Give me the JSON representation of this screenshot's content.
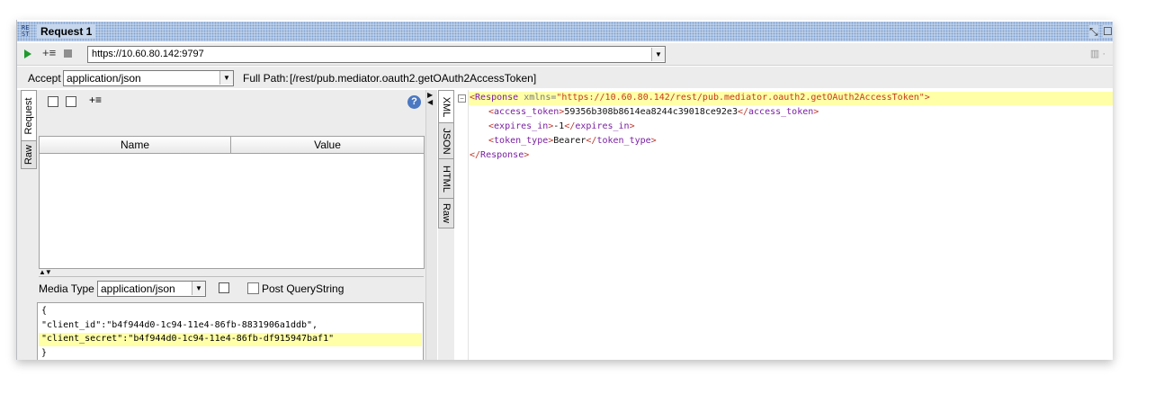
{
  "window": {
    "title": "Request 1",
    "badge_top": "RE",
    "badge_bottom": "ST",
    "controls": [
      "⤡",
      "☐"
    ]
  },
  "toolbar": {
    "url": "https://10.60.80.142:9797",
    "add_glyph": "+≡"
  },
  "accept": {
    "label": "Accept",
    "value": "application/json",
    "full_path_label": "Full Path:",
    "full_path": "[/rest/pub.mediator.oauth2.getOAuth2AccessToken]"
  },
  "left_tabs": [
    "Request",
    "Raw"
  ],
  "params": {
    "columns": [
      "Name",
      "Value"
    ],
    "rows": [],
    "help_glyph": "?"
  },
  "media": {
    "label": "Media Type",
    "value": "application/json",
    "post_qs_label": "Post QueryString"
  },
  "body_lines": [
    "{",
    "\"client_id\":\"b4f944d0-1c94-11e4-86fb-8831906a1ddb\",",
    "\"client_secret\":\"b4f944d0-1c94-11e4-86fb-df915947baf1\"",
    "}"
  ],
  "right_tabs": [
    "XML",
    "JSON",
    "HTML",
    "Raw"
  ],
  "response": {
    "root_tag": "Response",
    "xmlns_attr": "xmlns",
    "xmlns_value": "\"https://10.60.80.142/rest/pub.mediator.oauth2.getOAuth2AccessToken\"",
    "fields": [
      {
        "tag": "access_token",
        "value": "59356b308b8614ea8244c39018ce92e3"
      },
      {
        "tag": "expires_in",
        "value": "-1"
      },
      {
        "tag": "token_type",
        "value": "Bearer"
      }
    ]
  }
}
